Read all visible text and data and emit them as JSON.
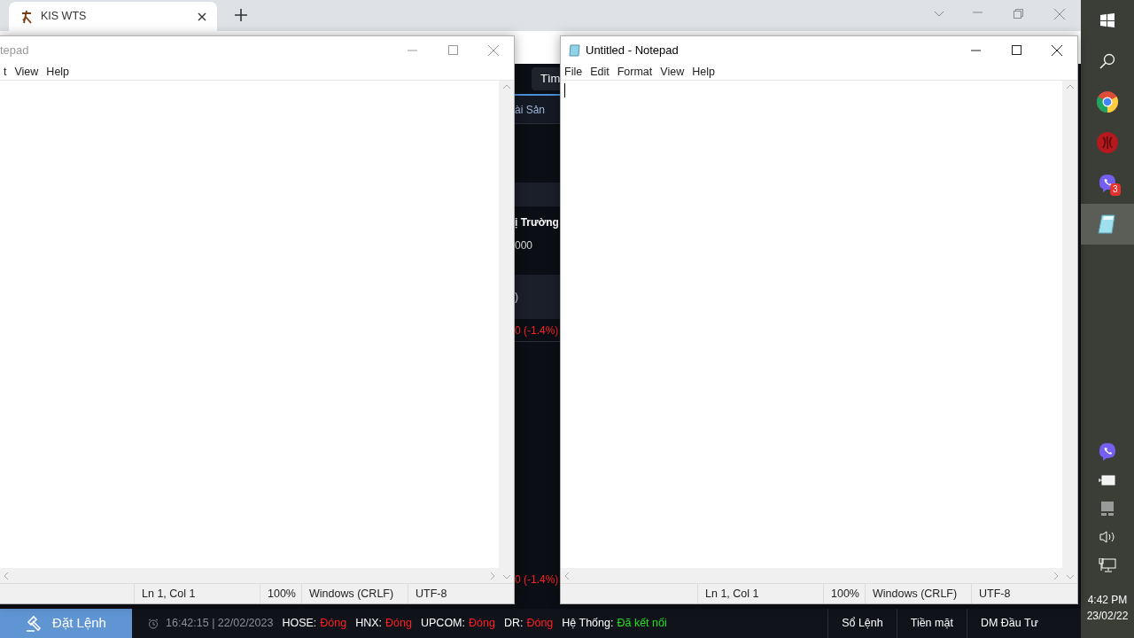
{
  "browser": {
    "tab": {
      "title": "KIS WTS"
    }
  },
  "app_fragments": {
    "search_button": "Tìm",
    "tab": "ài Sản",
    "market_label": "ị Trường",
    "value": "000",
    "paren": ")",
    "changes": [
      "0 (-1.4%)",
      "0 (-1.4%)"
    ]
  },
  "notepads": [
    {
      "title": "tepad",
      "active": false,
      "menu": [
        "t",
        "View",
        "Help"
      ],
      "status": [
        "Ln 1, Col 1",
        "100%",
        "Windows (CRLF)",
        "UTF-8"
      ]
    },
    {
      "title": "Untitled - Notepad",
      "active": true,
      "menu": [
        "File",
        "Edit",
        "Format",
        "View",
        "Help"
      ],
      "status": [
        "Ln 1, Col 1",
        "100%",
        "Windows (CRLF)",
        "UTF-8"
      ]
    }
  ],
  "bottom_bar": {
    "order_button": "Đặt Lệnh",
    "time": "16:42:15 | 22/02/2023",
    "exchanges": [
      {
        "label": "HOSE:",
        "status": "Đóng",
        "color": "#ff2020"
      },
      {
        "label": "HNX:",
        "status": "Đóng",
        "color": "#ff2020"
      },
      {
        "label": "UPCOM:",
        "status": "Đóng",
        "color": "#ff2020"
      },
      {
        "label": "DR:",
        "status": "Đóng",
        "color": "#ff2020"
      },
      {
        "label": "Hệ Thống:",
        "status": "Đã kết nối",
        "color": "#22e022"
      }
    ],
    "links": [
      "Sổ Lệnh",
      "Tiền mặt",
      "DM Đầu Tư"
    ]
  },
  "taskbar": {
    "apps": [
      {
        "kind": "start",
        "selected": false
      },
      {
        "kind": "search",
        "selected": false
      },
      {
        "kind": "chrome",
        "selected": false
      },
      {
        "kind": "rose",
        "selected": false
      },
      {
        "kind": "chat",
        "selected": false,
        "badge": "3"
      },
      {
        "kind": "notepad",
        "selected": true
      }
    ],
    "tray": [
      {
        "kind": "chat"
      },
      {
        "kind": "battery"
      },
      {
        "kind": "drive"
      },
      {
        "kind": "volume"
      },
      {
        "kind": "network"
      }
    ],
    "clock": {
      "time": "4:42 PM",
      "date": "23/02/22"
    }
  }
}
